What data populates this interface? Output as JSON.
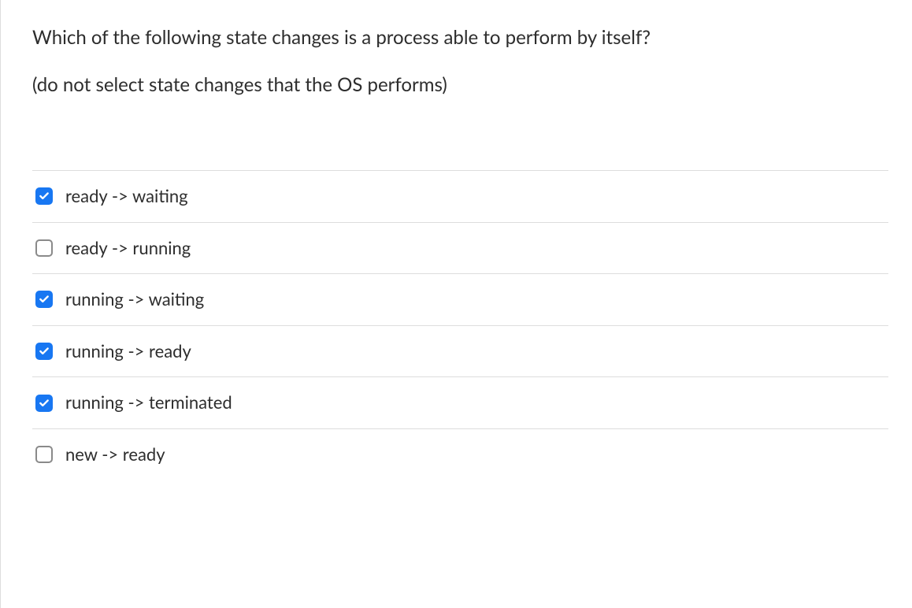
{
  "question": {
    "text": "Which of the following state changes is a process able to perform by itself?",
    "hint": "(do not select state changes that the OS performs)"
  },
  "options": [
    {
      "label": "ready -> waiting",
      "checked": true
    },
    {
      "label": "ready -> running",
      "checked": false
    },
    {
      "label": "running -> waiting",
      "checked": true
    },
    {
      "label": "running -> ready",
      "checked": true
    },
    {
      "label": "running -> terminated",
      "checked": true
    },
    {
      "label": "new -> ready",
      "checked": false
    }
  ]
}
